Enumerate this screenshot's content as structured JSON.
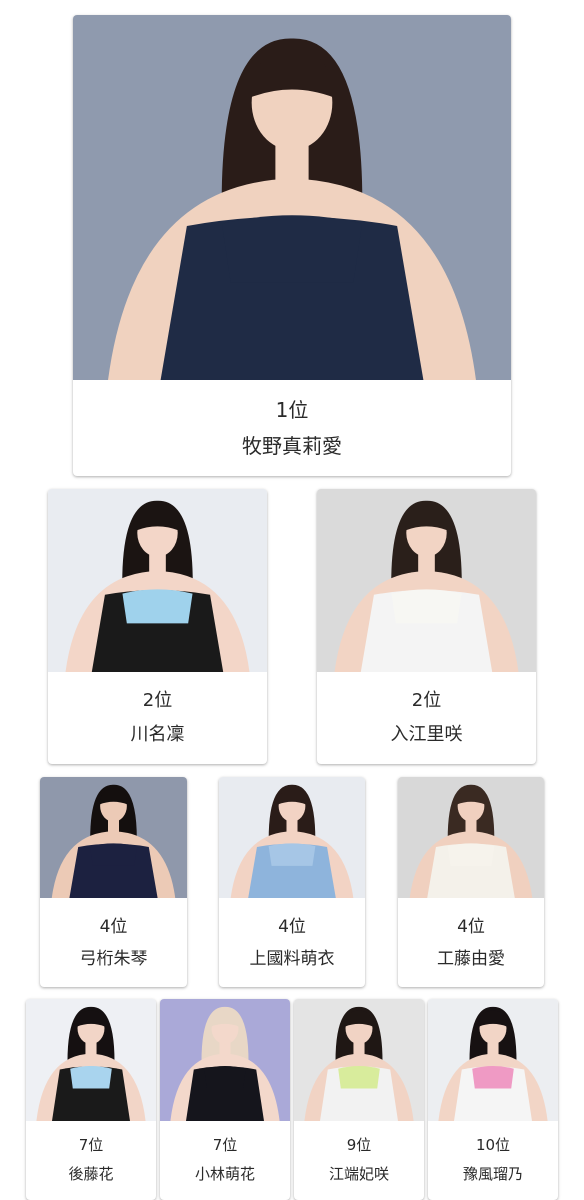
{
  "ranking": [
    {
      "rank": "1位",
      "name": "牧野真莉愛",
      "photo_bg": "#8f9aae",
      "outfit": "#1f2b45",
      "hair": "#2a1c18",
      "skin": "#f0d2bf",
      "top": "#1f2b45"
    },
    {
      "rank": "2位",
      "name": "川名凜",
      "photo_bg": "#e9ecf1",
      "outfit": "#1a1a1a",
      "hair": "#1b1412",
      "skin": "#f3d6c8",
      "top": "#9fd2ec"
    },
    {
      "rank": "2位",
      "name": "入江里咲",
      "photo_bg": "#dadada",
      "outfit": "#f4f4f4",
      "hair": "#2a1f1a",
      "skin": "#f2d4c4",
      "top": "#f7f7f3"
    },
    {
      "rank": "4位",
      "name": "弓桁朱琴",
      "photo_bg": "#8f98ab",
      "outfit": "#1c2140",
      "hair": "#140f0e",
      "skin": "#eccab6",
      "top": "#1c2140"
    },
    {
      "rank": "4位",
      "name": "上國料萌衣",
      "photo_bg": "#e8ebf0",
      "outfit": "#8eb4dc",
      "hair": "#2a1c18",
      "skin": "#f2d3c4",
      "top": "#a6c6e6"
    },
    {
      "rank": "4位",
      "name": "工藤由愛",
      "photo_bg": "#d8d8d8",
      "outfit": "#f4f1ea",
      "hair": "#3a2a22",
      "skin": "#f0d0bf",
      "top": "#f6f3ec"
    },
    {
      "rank": "7位",
      "name": "後藤花",
      "photo_bg": "#eef0f4",
      "outfit": "#1a1a1a",
      "hair": "#151011",
      "skin": "#f2d5c7",
      "top": "#a9d4ee"
    },
    {
      "rank": "7位",
      "name": "小林萌花",
      "photo_bg": "#aaa9d8",
      "outfit": "#15151c",
      "hair": "#e8d7c6",
      "skin": "#f3d8cb",
      "top": "#15151c"
    },
    {
      "rank": "9位",
      "name": "江端妃咲",
      "photo_bg": "#e4e4e4",
      "outfit": "#f2f2f2",
      "hair": "#1f1714",
      "skin": "#f1d3c4",
      "top": "#d8ec9c"
    },
    {
      "rank": "10位",
      "name": "豫風瑠乃",
      "photo_bg": "#eceef1",
      "outfit": "#f5f5f5",
      "hair": "#171112",
      "skin": "#f2d5c6",
      "top": "#ef9ac4"
    }
  ]
}
